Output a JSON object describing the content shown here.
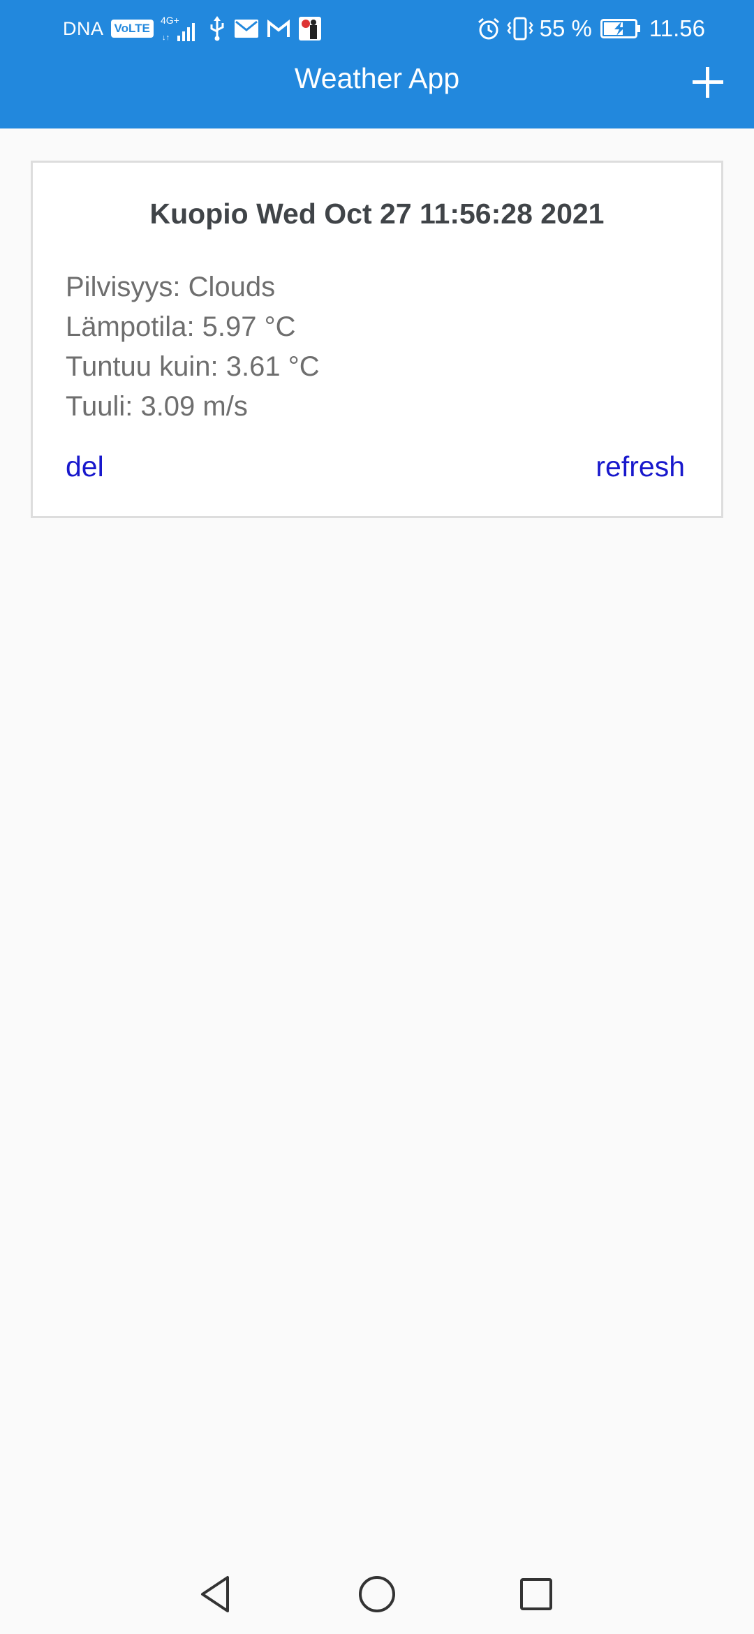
{
  "status_bar": {
    "carrier": "DNA",
    "volte": "VoLTE",
    "network": "4G+",
    "battery_percent": "55 %",
    "time": "11.56",
    "icons": [
      "signal-icon",
      "usb-icon",
      "mail-icon",
      "gmail-icon",
      "app-notification-icon",
      "alarm-icon",
      "vibrate-icon",
      "battery-charging-icon"
    ]
  },
  "app_bar": {
    "title": "Weather App",
    "add_icon": "plus-icon"
  },
  "cards": [
    {
      "title": "Kuopio Wed Oct 27 11:56:28 2021",
      "lines": [
        "Pilvisyys: Clouds",
        "Lämpotila: 5.97 °C",
        "Tuntuu kuin: 3.61 °C",
        "Tuuli: 3.09 m/s"
      ],
      "delete_label": "del",
      "refresh_label": "refresh"
    }
  ],
  "nav_bar": {
    "icons": [
      "back-icon",
      "home-icon",
      "recents-icon"
    ]
  },
  "colors": {
    "app_bar": "#2288dd",
    "link": "#1818cc",
    "background": "#fafafa"
  }
}
